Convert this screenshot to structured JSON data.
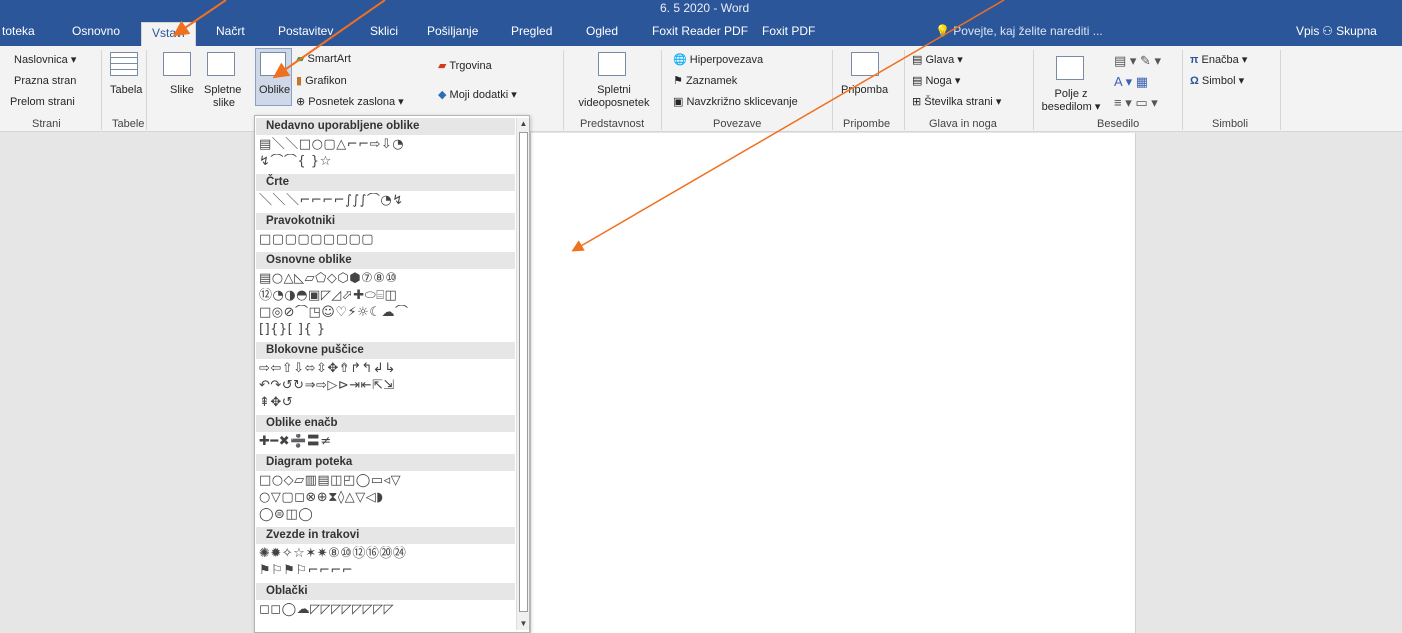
{
  "window": {
    "title": "6. 5 2020 - Word"
  },
  "tabs": [
    {
      "label": "toteka"
    },
    {
      "label": "Osnovno"
    },
    {
      "label": "Vstavi"
    },
    {
      "label": "Načrt"
    },
    {
      "label": "Postavitev"
    },
    {
      "label": "Sklici"
    },
    {
      "label": "Pošiljanje"
    },
    {
      "label": "Pregled"
    },
    {
      "label": "Ogled"
    },
    {
      "label": "Foxit Reader PDF"
    },
    {
      "label": "Foxit PDF"
    }
  ],
  "tellme": "Povejte, kaj želite narediti ...",
  "signin": "Vpis",
  "share": "Skupna",
  "ribbon": {
    "pages": {
      "cover": "Naslovnica",
      "blank": "Prazna stran",
      "break": "Prelom strani",
      "label": "Strani"
    },
    "tables": {
      "table": "Tabela",
      "label": "Tabele"
    },
    "illustrations": {
      "pictures": "Slike",
      "online1": "Spletne",
      "online2": "slike",
      "shapes": "Oblike",
      "smartart": "SmartArt",
      "chart": "Grafikon",
      "screenshot": "Posnetek zaslona"
    },
    "addins": {
      "store": "Trgovina",
      "myaddins": "Moji dodatki"
    },
    "media": {
      "video1": "Spletni",
      "video2": "videoposnetek",
      "label": "Predstavnost"
    },
    "links": {
      "hyperlink": "Hiperpovezava",
      "bookmark": "Zaznamek",
      "crossref": "Navzkrižno sklicevanje",
      "label": "Povezave"
    },
    "comments": {
      "comment": "Pripomba",
      "label": "Pripombe"
    },
    "headerfooter": {
      "header": "Glava",
      "footer": "Noga",
      "pagenum": "Številka strani",
      "label": "Glava in noga"
    },
    "text": {
      "textbox1": "Polje z",
      "textbox2": "besedilom",
      "label": "Besedilo"
    },
    "symbols": {
      "equation": "Enačba",
      "symbol": "Simbol",
      "label": "Simboli"
    }
  },
  "gallery": {
    "sections": [
      {
        "title": "Nedavno uporabljene oblike",
        "rows": [
          "▤＼＼□○▢△⌐⌐⇨⇩◔",
          "↯⌒⌒{ }☆"
        ]
      },
      {
        "title": "Črte",
        "rows": [
          "＼＼＼⌐⌐⌐⌐∫∫∫⌒◔↯"
        ]
      },
      {
        "title": "Pravokotniki",
        "rows": [
          "□▢▢▢▢▢▢▢▢"
        ]
      },
      {
        "title": "Osnovne oblike",
        "rows": [
          "▤○△◺▱⬠◇⬡⬢⑦⑧⑩",
          "⑫◔◑◓▣◸◿⬀✚⬭⌸◫",
          "□◎⊘⌒◳☺♡⚡☼☾☁⌒",
          "[]{}[ ]{ }"
        ]
      },
      {
        "title": "Blokovne puščice",
        "rows": [
          "⇨⇦⇧⇩⬄⇳✥⇮↱↰↲↳",
          "↶↷↺↻⇒⇨▷⊳⇥⇤⇱⇲",
          "⇞✥↺"
        ]
      },
      {
        "title": "Oblike enačb",
        "rows": [
          "✚━✖➗〓≠"
        ]
      },
      {
        "title": "Diagram poteka",
        "rows": [
          "□○◇▱▥▤◫◰◯▭◃▽",
          "○▽▢◻⊗⊕⧗◊△▽◁◗",
          "◯⊜◫◯"
        ]
      },
      {
        "title": "Zvezde in trakovi",
        "rows": [
          "✺✹✧☆✶✷⑧⑩⑫⑯⑳㉔",
          "⚑⚐⚑⚐⌐⌐⌐⌐"
        ]
      },
      {
        "title": "Oblački",
        "rows": [
          "◻◻◯☁◸◸◸◸◸◸◸◸"
        ]
      }
    ]
  },
  "colors": {
    "accent": "#2b579a",
    "arrow": "#f07020"
  }
}
